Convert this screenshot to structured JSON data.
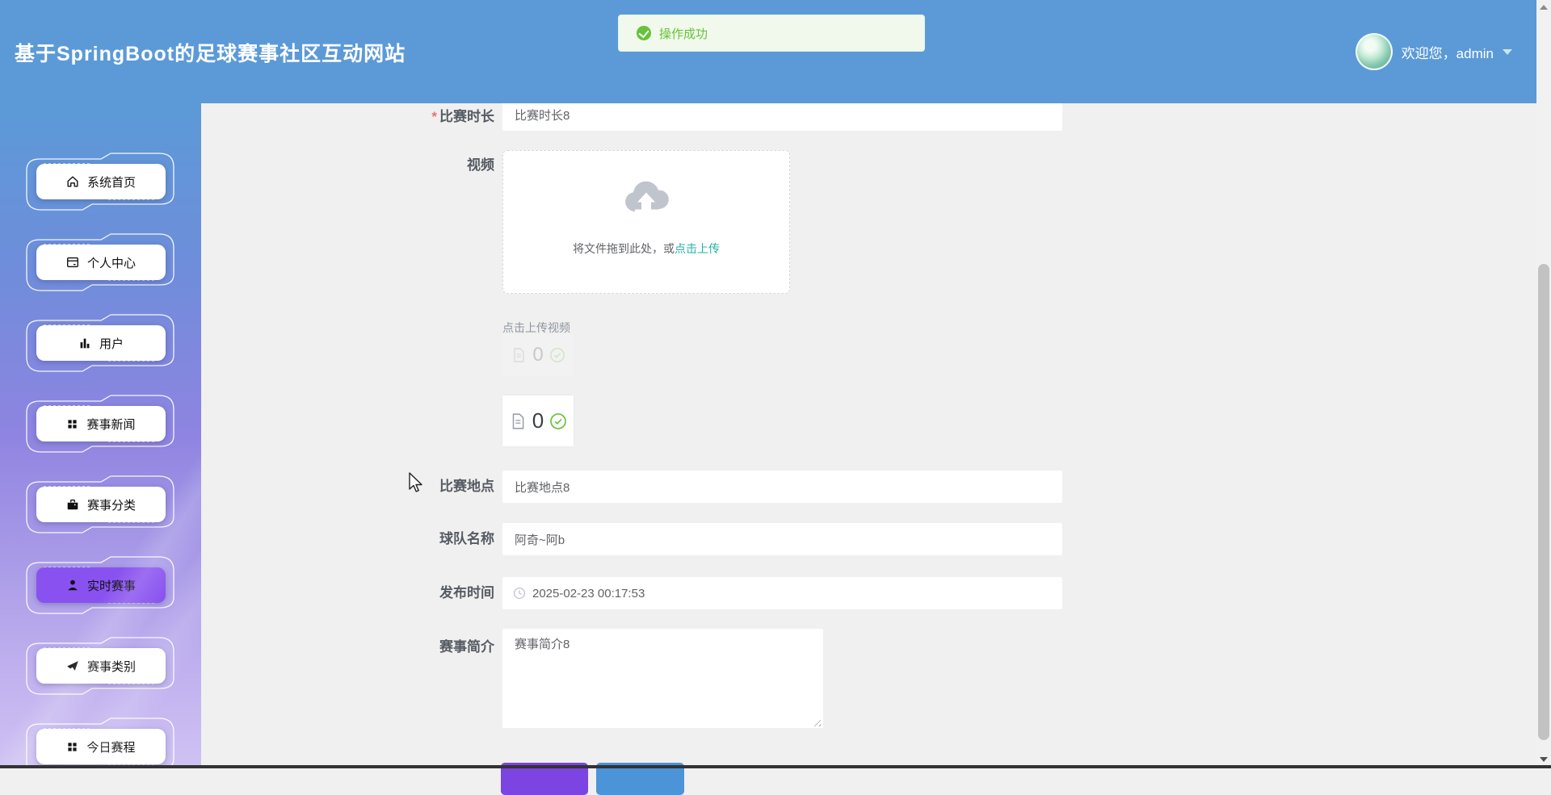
{
  "header": {
    "title": "基于SpringBoot的足球赛事社区互动网站",
    "welcome": "欢迎您，admin"
  },
  "toast": {
    "message": "操作成功"
  },
  "sidebar": {
    "items": [
      {
        "label": "系统首页",
        "icon": "home-icon",
        "active": false
      },
      {
        "label": "个人中心",
        "icon": "profile-card-icon",
        "active": false
      },
      {
        "label": "用户",
        "icon": "bar-chart-icon",
        "active": false
      },
      {
        "label": "赛事新闻",
        "icon": "grid-icon",
        "active": false
      },
      {
        "label": "赛事分类",
        "icon": "briefcase-icon",
        "active": false
      },
      {
        "label": "实时赛事",
        "icon": "user-icon",
        "active": true
      },
      {
        "label": "赛事类别",
        "icon": "paper-plane-icon",
        "active": false
      },
      {
        "label": "今日赛程",
        "icon": "grid-icon",
        "active": false
      }
    ]
  },
  "form": {
    "duration": {
      "label": "比赛时长",
      "required_mark": "*",
      "value": "比赛时长8"
    },
    "video": {
      "label": "视频",
      "drop_text": "将文件拖到此处，或",
      "upload_link": "点击上传",
      "hint": "点击上传视频",
      "ghost_count": "0",
      "count": "0"
    },
    "location": {
      "label": "比赛地点",
      "value": "比赛地点8"
    },
    "team": {
      "label": "球队名称",
      "value": "阿奇~阿b"
    },
    "publish_time": {
      "label": "发布时间",
      "value": "2025-02-23 00:17:53"
    },
    "intro": {
      "label": "赛事简介",
      "value": "赛事简介8"
    }
  },
  "colors": {
    "header_blue": "#5b9ad7",
    "sidebar_active_purple": "#8952f0",
    "success_green": "#67c23a",
    "upload_link_teal": "#21b3a3",
    "button_purple": "#7c44e0",
    "button_blue": "#4b94d8"
  }
}
